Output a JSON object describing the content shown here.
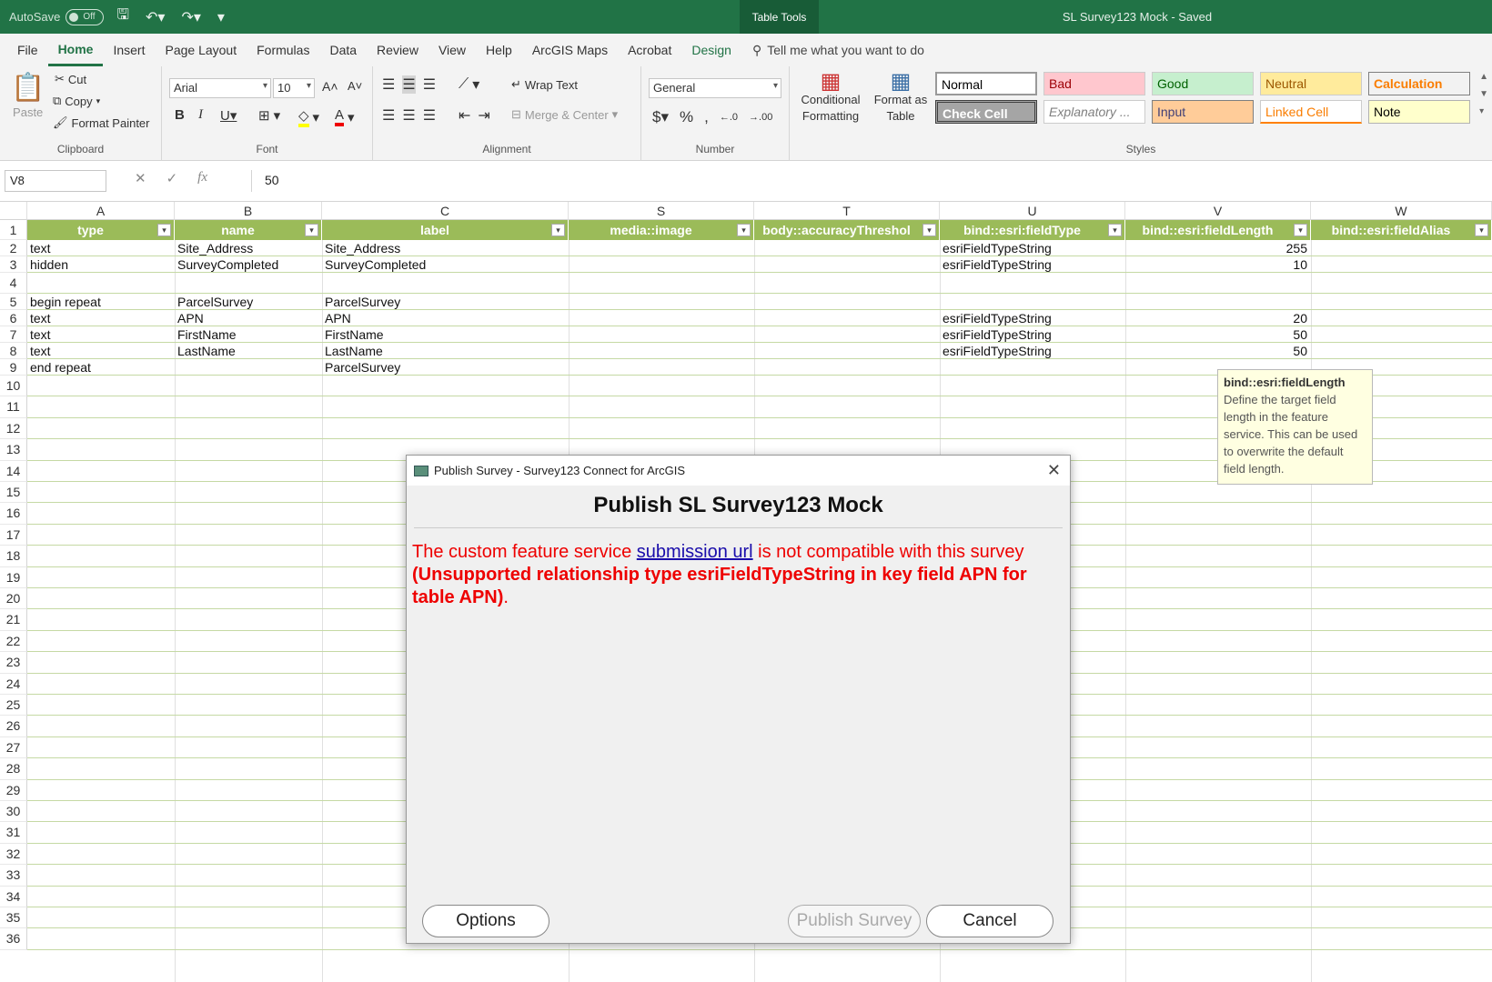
{
  "titlebar": {
    "autosave_label": "AutoSave",
    "autosave_state": "Off",
    "context_tab": "Table Tools",
    "doc_title": "SL Survey123 Mock  -  Saved"
  },
  "menu": {
    "tabs": [
      "File",
      "Home",
      "Insert",
      "Page Layout",
      "Formulas",
      "Data",
      "Review",
      "View",
      "Help",
      "ArcGIS Maps",
      "Acrobat",
      "Design"
    ],
    "tell_me": "Tell me what you want to do"
  },
  "ribbon": {
    "clipboard": {
      "paste": "Paste",
      "cut": "Cut",
      "copy": "Copy",
      "format_painter": "Format Painter",
      "label": "Clipboard"
    },
    "font": {
      "name": "Arial",
      "size": "10",
      "label": "Font"
    },
    "alignment": {
      "wrap": "Wrap Text",
      "merge": "Merge & Center",
      "label": "Alignment"
    },
    "number": {
      "format": "General",
      "label": "Number"
    },
    "styles": {
      "conditional": "Conditional Formatting",
      "format_table": "Format as Table",
      "label": "Styles",
      "cells": [
        "Normal",
        "Bad",
        "Good",
        "Neutral",
        "Calculation",
        "Check Cell",
        "Explanatory ...",
        "Input",
        "Linked Cell",
        "Note"
      ]
    }
  },
  "formula_bar": {
    "name_box": "V8",
    "value": "50"
  },
  "sheet": {
    "columns": [
      "A",
      "B",
      "C",
      "S",
      "T",
      "U",
      "V",
      "W"
    ],
    "headers": [
      "type",
      "name",
      "label",
      "media::image",
      "body::accuracyThreshol",
      "bind::esri:fieldType",
      "bind::esri:fieldLength",
      "bind::esri:fieldAlias"
    ],
    "rows": [
      [
        "text",
        "Site_Address",
        "Site_Address",
        "",
        "",
        "esriFieldTypeString",
        "255",
        ""
      ],
      [
        "hidden",
        "SurveyCompleted",
        "SurveyCompleted",
        "",
        "",
        "esriFieldTypeString",
        "10",
        ""
      ],
      [
        "",
        "",
        "",
        "",
        "",
        "",
        "",
        ""
      ],
      [
        "begin repeat",
        "ParcelSurvey",
        "ParcelSurvey",
        "",
        "",
        "",
        "",
        ""
      ],
      [
        "text",
        "APN",
        "APN",
        "",
        "",
        "esriFieldTypeString",
        "20",
        ""
      ],
      [
        "text",
        "FirstName",
        "FirstName",
        "",
        "",
        "esriFieldTypeString",
        "50",
        ""
      ],
      [
        "text",
        "LastName",
        "LastName",
        "",
        "",
        "esriFieldTypeString",
        "50",
        ""
      ],
      [
        "end repeat",
        "",
        "ParcelSurvey",
        "",
        "",
        "",
        "",
        ""
      ]
    ],
    "row_numbers": [
      "1",
      "2",
      "3",
      "4",
      "5",
      "6",
      "7",
      "8",
      "9",
      "10",
      "11",
      "12",
      "13",
      "14",
      "15",
      "16",
      "17",
      "18",
      "19",
      "20",
      "21",
      "22",
      "23",
      "24",
      "25",
      "26",
      "27",
      "28",
      "29",
      "30",
      "31",
      "32",
      "33",
      "34",
      "35",
      "36"
    ]
  },
  "tooltip": {
    "title": "bind::esri:fieldLength",
    "body": "Define the target field length in the feature service. This can be used to overwrite the default field length."
  },
  "dialog": {
    "window_title": "Publish Survey - Survey123 Connect for ArcGIS",
    "heading": "Publish SL Survey123 Mock",
    "msg_prefix": "The custom feature service ",
    "msg_link": "submission url",
    "msg_suffix": " is not compatible with this survey",
    "msg_bold": "(Unsupported relationship type esriFieldTypeString in key field APN for table APN)",
    "msg_end": ".",
    "options_label": "Options",
    "publish_label": "Publish Survey",
    "cancel_label": "Cancel"
  }
}
